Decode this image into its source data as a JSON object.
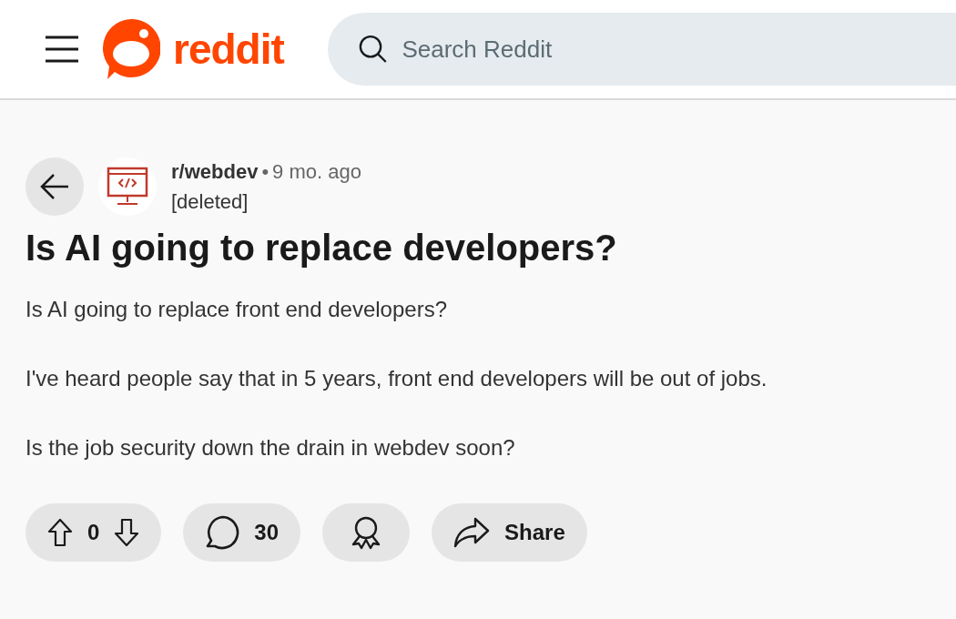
{
  "header": {
    "logo_text": "reddit",
    "search": {
      "placeholder": "Search Reddit"
    }
  },
  "post": {
    "subreddit": "r/webdev",
    "separator": "•",
    "time": "9 mo. ago",
    "author": "[deleted]",
    "title": "Is AI going to replace developers?",
    "body": [
      "Is AI going to replace front end developers?",
      "I've heard people say that in 5 years, front end developers will be out of jobs.",
      "Is the job security down the drain in webdev soon?"
    ]
  },
  "actions": {
    "score": "0",
    "comments": "30",
    "share": "Share"
  }
}
